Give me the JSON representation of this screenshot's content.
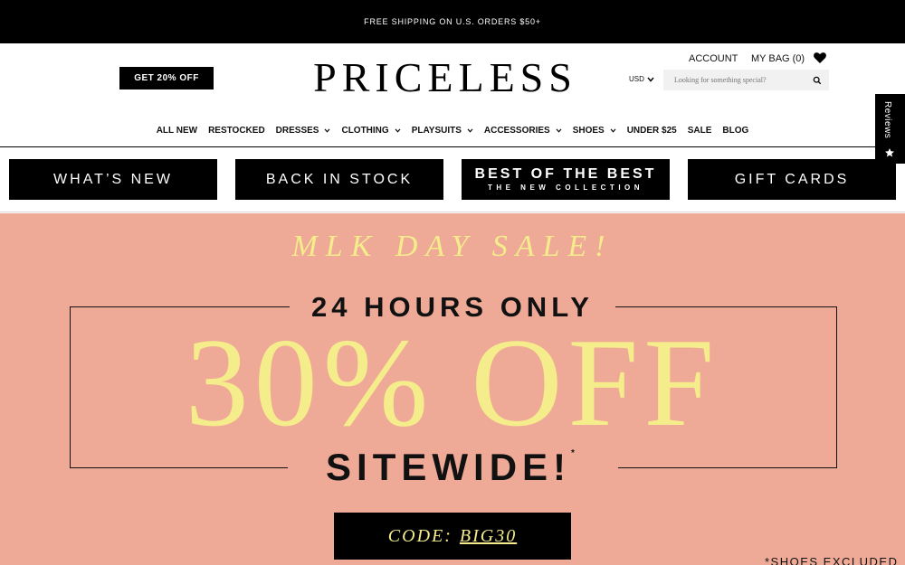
{
  "topbar": {
    "text": "FREE SHIPPING ON U.S. ORDERS $50+"
  },
  "header": {
    "promo_label": "GET 20% OFF",
    "logo": "PRICELESS",
    "account_label": "ACCOUNT",
    "bag_label": "MY BAG (0)",
    "currency": "USD",
    "search_placeholder": "Looking for something special?"
  },
  "nav": {
    "items": [
      {
        "label": "ALL NEW",
        "dropdown": false
      },
      {
        "label": "RESTOCKED",
        "dropdown": false
      },
      {
        "label": "DRESSES",
        "dropdown": true
      },
      {
        "label": "CLOTHING",
        "dropdown": true
      },
      {
        "label": "PLAYSUITS",
        "dropdown": true
      },
      {
        "label": "ACCESSORIES",
        "dropdown": true
      },
      {
        "label": "SHOES",
        "dropdown": true
      },
      {
        "label": "UNDER $25",
        "dropdown": false
      },
      {
        "label": "SALE",
        "dropdown": false
      },
      {
        "label": "BLOG",
        "dropdown": false
      }
    ]
  },
  "categories": {
    "whats_new": "WHAT’S NEW",
    "back_in_stock": "BACK IN STOCK",
    "best_main": "BEST OF THE BEST",
    "best_sub": "THE NEW COLLECTION",
    "gift_cards": "GIFT CARDS"
  },
  "reviews_tab": {
    "label": "Reviews"
  },
  "hero": {
    "sale_title": "MLK DAY SALE!",
    "hours": "24 HOURS ONLY",
    "discount": "30% OFF",
    "sitewide": "SITEWIDE!",
    "asterisk": "*",
    "code_label": "CODE:",
    "code_value": "BIG30",
    "shoes_note": "*SHOES EXCLUDED"
  },
  "colors": {
    "hero_bg": "#eeaa96",
    "accent_yellow": "#f5ec8c",
    "black": "#000000"
  }
}
